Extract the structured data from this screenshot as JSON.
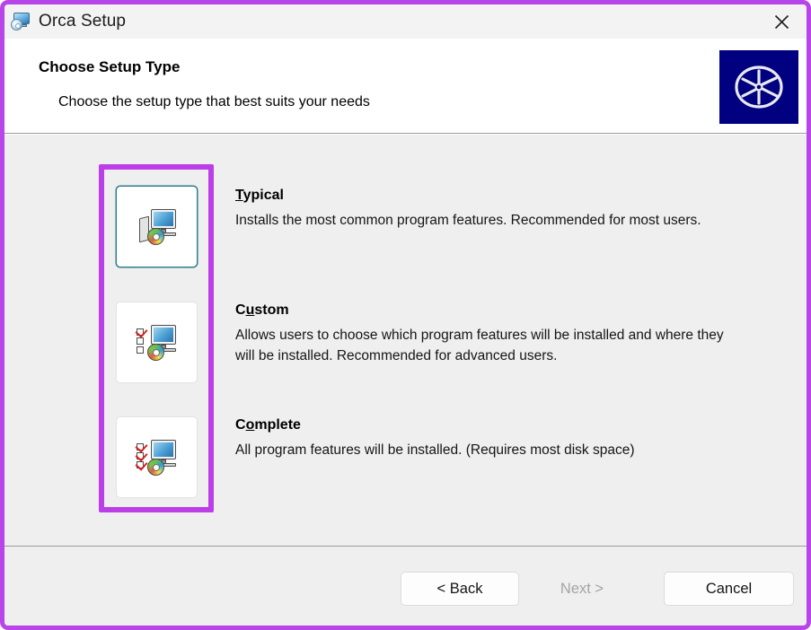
{
  "window": {
    "title": "Orca Setup",
    "title_icon": "setup-disc-monitor-icon",
    "close_icon": "close-x-icon",
    "accent_color": "#b845e8"
  },
  "header": {
    "title": "Choose Setup Type",
    "subtitle": "Choose the setup type that best suits your needs",
    "logo_icon": "cd-disc-logo",
    "logo_background": "#000080"
  },
  "options": [
    {
      "id": "typical",
      "title_prefix": "",
      "title_accel": "T",
      "title_suffix": "ypical",
      "title_full": "Typical",
      "description": "Installs the most common program features. Recommended for most users.",
      "icon": "computer-cd-icon",
      "selected": true,
      "checks": []
    },
    {
      "id": "custom",
      "title_prefix": "C",
      "title_accel": "u",
      "title_suffix": "stom",
      "title_full": "Custom",
      "description": "Allows users to choose which program features will be installed and where they will be installed. Recommended for advanced users.",
      "icon": "checklist-computer-cd-icon",
      "selected": false,
      "checks": [
        true,
        false,
        false
      ]
    },
    {
      "id": "complete",
      "title_prefix": "C",
      "title_accel": "o",
      "title_suffix": "mplete",
      "title_full": "Complete",
      "description": "All program features will be installed.  (Requires most disk space)",
      "icon": "full-checklist-computer-cd-icon",
      "selected": false,
      "checks": [
        true,
        true,
        true
      ]
    }
  ],
  "footer": {
    "back_label": "< Back",
    "next_label": "Next >",
    "cancel_label": "Cancel",
    "next_disabled": true
  },
  "annotation": {
    "shape": "rectangle-highlight",
    "color": "#bb3ee8",
    "target": "setup-type-icon-column"
  }
}
